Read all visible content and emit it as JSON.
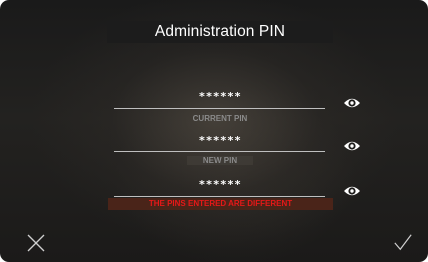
{
  "title": "Administration PIN",
  "fields": [
    {
      "value": "******",
      "label": "CURRENT PIN",
      "reveal_icon": "eye-icon"
    },
    {
      "value": "******",
      "label": "NEW PIN",
      "reveal_icon": "eye-icon"
    },
    {
      "value": "******",
      "label": "THE PINS ENTERED ARE DIFFERENT",
      "reveal_icon": "eye-icon",
      "label_is_error": true
    }
  ],
  "actions": {
    "cancel_icon": "close-icon",
    "confirm_icon": "checkmark-icon"
  },
  "colors": {
    "error_text": "#e51818",
    "error_background": "#4a2419",
    "text": "#ffffff",
    "label": "#8a8a8a"
  }
}
